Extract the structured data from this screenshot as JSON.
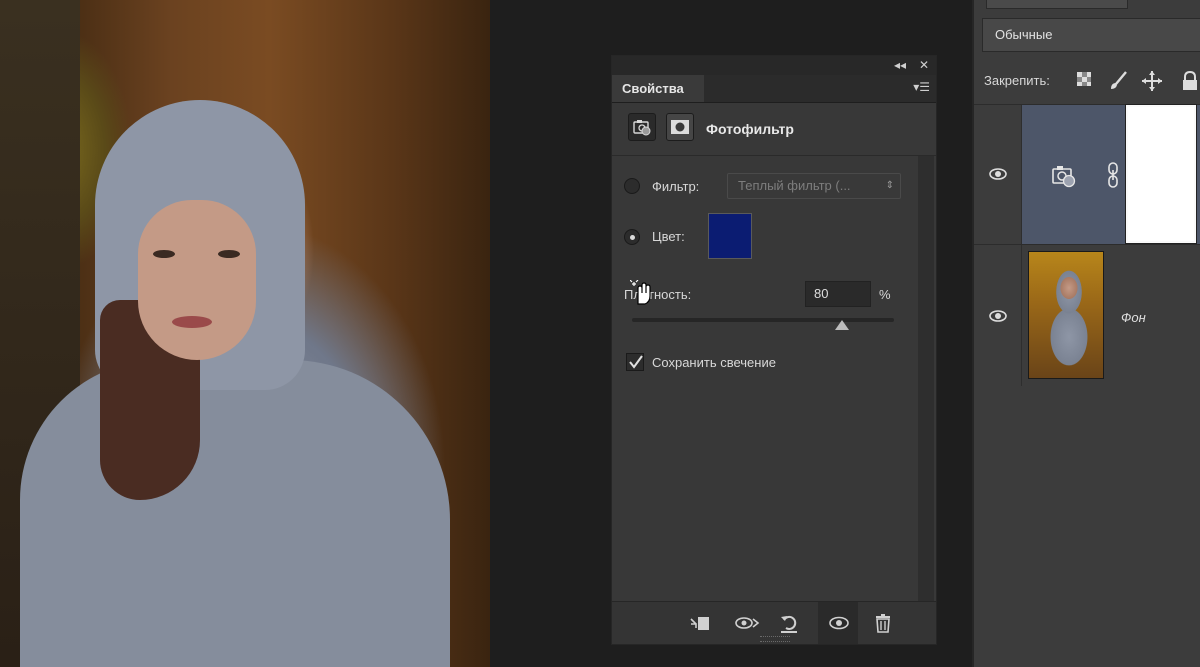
{
  "properties": {
    "panel_title": "Свойства",
    "adjustment_name": "Фотофильтр",
    "filter_label": "Фильтр:",
    "filter_value": "Теплый фильтр (...",
    "color_label": "Цвет:",
    "color_swatch": "#0b1c72",
    "density_label": "Плотность:",
    "density_value": "80",
    "density_unit": "%",
    "density_slider_level": 80,
    "preserve_luminosity_label": "Сохранить свечение",
    "preserve_luminosity_checked": true,
    "selected_mode": "color"
  },
  "layers": {
    "blend_mode": "Обычные",
    "lock_label": "Закрепить:",
    "items": [
      {
        "name": "",
        "type": "adjustment-photo-filter",
        "visible": true,
        "selected": true
      },
      {
        "name": "Фон",
        "type": "background",
        "visible": true,
        "selected": false
      }
    ]
  },
  "icons": {
    "collapse": "double-chevron-left-icon",
    "close": "close-icon",
    "panel_menu": "panel-menu-icon",
    "adjustment_type": "photo-filter-icon",
    "mask": "mask-icon",
    "bottom": [
      "clip-to-layer-icon",
      "view-previous-state-icon",
      "reset-icon",
      "visibility-icon",
      "trash-icon"
    ],
    "locks": [
      "lock-transparent-icon",
      "lock-paint-icon",
      "lock-move-icon",
      "lock-all-icon"
    ]
  }
}
